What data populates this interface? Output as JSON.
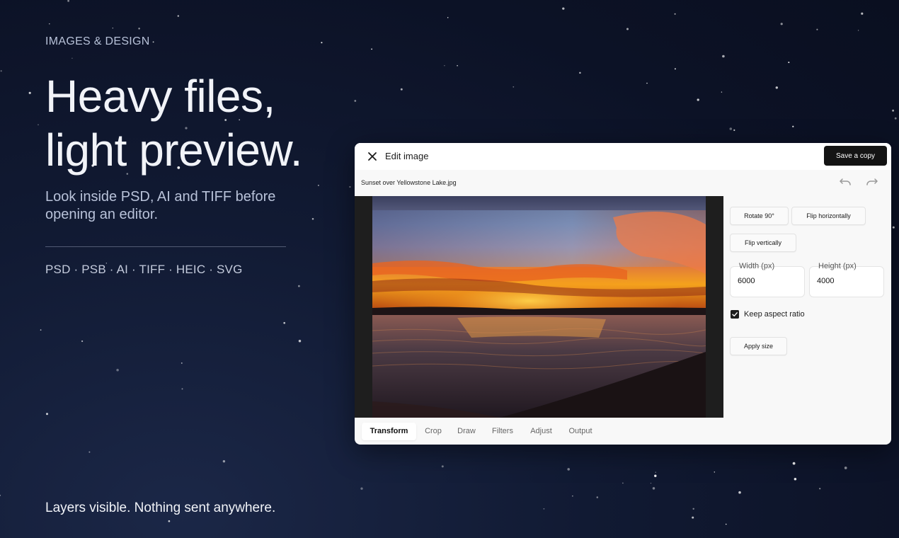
{
  "hero": {
    "eyebrow": "IMAGES & DESIGN",
    "headline_line1": "Heavy files,",
    "headline_line2": "light preview.",
    "subhead_line1": "Look inside PSD, AI and TIFF before",
    "subhead_line2": "opening an editor.",
    "formats": "PSD · PSB · AI · TIFF · HEIC · SVG",
    "footer": "Layers visible. Nothing sent anywhere."
  },
  "editor": {
    "title": "Edit image",
    "close_icon": "close-icon",
    "save_label": "Save a copy",
    "file_name": "Sunset over Yellowstone Lake.jpg",
    "undo_icon": "undo-icon",
    "redo_icon": "redo-icon",
    "transform": {
      "rotate_label": "Rotate 90°",
      "flip_h_label": "Flip horizontally",
      "flip_v_label": "Flip vertically",
      "width_label": "Width (px)",
      "width_value": "6000",
      "height_label": "Height (px)",
      "height_value": "4000",
      "keep_aspect_label": "Keep aspect ratio",
      "keep_aspect_checked": true,
      "apply_label": "Apply size"
    },
    "tabs": [
      {
        "label": "Transform",
        "active": true
      },
      {
        "label": "Crop",
        "active": false
      },
      {
        "label": "Draw",
        "active": false
      },
      {
        "label": "Filters",
        "active": false
      },
      {
        "label": "Adjust",
        "active": false
      },
      {
        "label": "Output",
        "active": false
      }
    ]
  },
  "colors": {
    "background": "#0c1226",
    "save_button": "#141414",
    "panel": "#f8f8f8"
  }
}
